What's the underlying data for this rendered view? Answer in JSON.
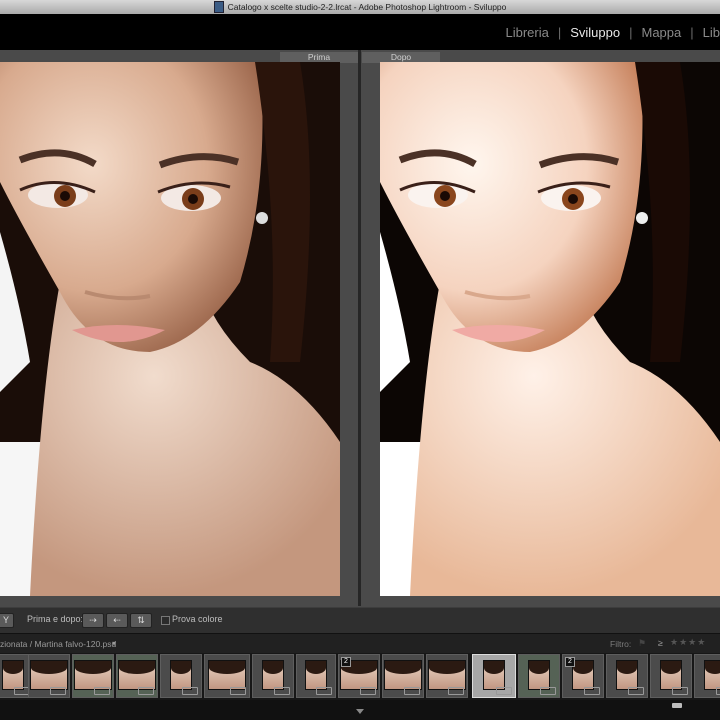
{
  "window": {
    "title": "Catalogo x scelte studio-2-2.lrcat - Adobe Photoshop Lightroom - Sviluppo"
  },
  "modules": [
    {
      "label": "Libreria",
      "active": false
    },
    {
      "label": "Sviluppo",
      "active": true
    },
    {
      "label": "Mappa",
      "active": false
    },
    {
      "label": "Lib",
      "active": false
    }
  ],
  "panes": {
    "before_label": "Prima",
    "after_label": "Dopo"
  },
  "toolbar": {
    "view_mode": "Y",
    "before_after_label": "Prima e dopo:",
    "soft_proof_label": "Prova colore"
  },
  "filmstrip_header": {
    "source": "zionata / Martina falvo-120.psd",
    "filter_label": "Filtro:",
    "filter_symbol": "≥"
  },
  "filmstrip": {
    "thumbs": [
      {
        "stack": "",
        "group": false,
        "selected": false,
        "shape": "tall"
      },
      {
        "stack": "",
        "group": false,
        "selected": false,
        "shape": "wide"
      },
      {
        "stack": "",
        "group": true,
        "selected": false,
        "shape": "wide"
      },
      {
        "stack": "",
        "group": true,
        "selected": false,
        "shape": "wide"
      },
      {
        "stack": "",
        "group": false,
        "selected": false,
        "shape": "tall"
      },
      {
        "stack": "",
        "group": false,
        "selected": false,
        "shape": "wide"
      },
      {
        "stack": "",
        "group": false,
        "selected": false,
        "shape": "tall"
      },
      {
        "stack": "",
        "group": false,
        "selected": false,
        "shape": "tall"
      },
      {
        "stack": "2",
        "group": false,
        "selected": false,
        "shape": "wide"
      },
      {
        "stack": "",
        "group": false,
        "selected": false,
        "shape": "wide"
      },
      {
        "stack": "",
        "group": false,
        "selected": false,
        "shape": "wide"
      },
      {
        "stack": "",
        "group": false,
        "selected": true,
        "shape": "tall"
      },
      {
        "stack": "",
        "group": true,
        "selected": false,
        "shape": "tall"
      },
      {
        "stack": "2",
        "group": false,
        "selected": false,
        "shape": "tall"
      },
      {
        "stack": "",
        "group": false,
        "selected": false,
        "shape": "tall"
      },
      {
        "stack": "",
        "group": false,
        "selected": false,
        "shape": "tall"
      },
      {
        "stack": "",
        "group": false,
        "selected": false,
        "shape": "tall"
      }
    ]
  },
  "colors": {
    "accent": "#e8e8e8",
    "background": "#4a4a4a"
  }
}
